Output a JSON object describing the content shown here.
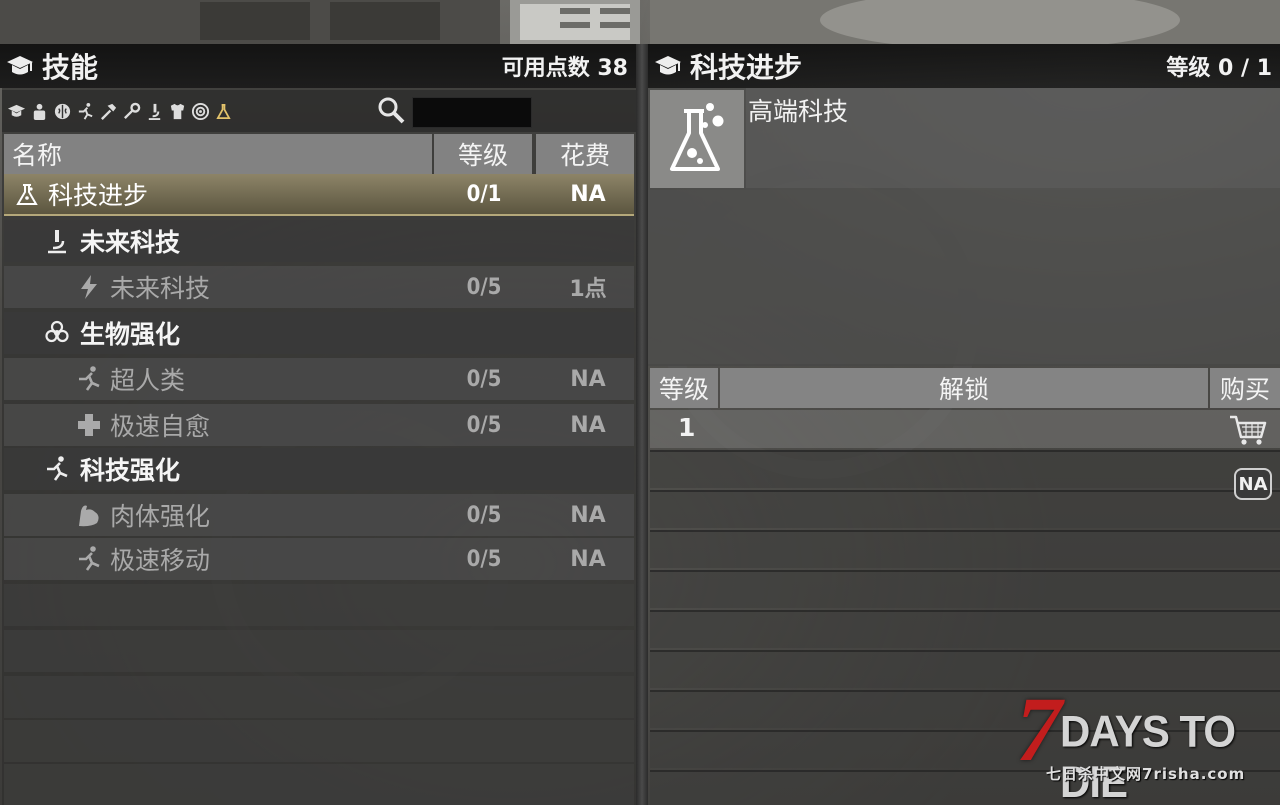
{
  "left_panel": {
    "title": "技能",
    "points_label": "可用点数",
    "points_value": "38",
    "filter_icons": [
      "graduation-cap-icon",
      "person-icon",
      "brain-icon",
      "run-icon",
      "hammer-icon",
      "wrench-icon",
      "microscope-icon",
      "biohazard-icon",
      "target-icon",
      "flask-icon"
    ],
    "search": {
      "value": "",
      "placeholder": ""
    },
    "columns": {
      "name": "名称",
      "level": "等级",
      "cost": "花费"
    },
    "rows": [
      {
        "type": "selected",
        "icon": "flask-icon",
        "name": "科技进步",
        "level": "0/1",
        "cost": "NA"
      },
      {
        "type": "cat",
        "icon": "microscope-icon",
        "name": "未来科技",
        "level": "",
        "cost": ""
      },
      {
        "type": "sub",
        "icon": "lightning-icon",
        "name": "未来科技",
        "level": "0/5",
        "cost": "1点"
      },
      {
        "type": "cat",
        "icon": "biohazard-icon",
        "name": "生物强化",
        "level": "",
        "cost": ""
      },
      {
        "type": "sub",
        "icon": "run-icon",
        "name": "超人类",
        "level": "0/5",
        "cost": "NA"
      },
      {
        "type": "sub",
        "icon": "medical-cross-icon",
        "name": "极速自愈",
        "level": "0/5",
        "cost": "NA"
      },
      {
        "type": "cat",
        "icon": "run-icon",
        "name": "科技强化",
        "level": "",
        "cost": ""
      },
      {
        "type": "sub",
        "icon": "muscle-arm-icon",
        "name": "肉体强化",
        "level": "0/5",
        "cost": "NA"
      },
      {
        "type": "sub",
        "icon": "run-icon",
        "name": "极速移动",
        "level": "0/5",
        "cost": "NA"
      }
    ]
  },
  "right_panel": {
    "title": "科技进步",
    "level_label": "等级",
    "level_value": "0 / 1",
    "detail_title": "高端科技",
    "tier_columns": {
      "level": "等级",
      "unlock": "解锁",
      "buy": "购买"
    },
    "tiers": [
      {
        "level": "1",
        "unlock": "",
        "buy": "cart-icon"
      }
    ],
    "badge": "NA"
  },
  "watermark": {
    "logo": "7DAYS TO DIE",
    "site": "七日杀中文网7risha.com"
  },
  "colors": {
    "selected_row": "#8d8468",
    "header_bg": "#828282",
    "watermark_red": "#c21d1d"
  }
}
